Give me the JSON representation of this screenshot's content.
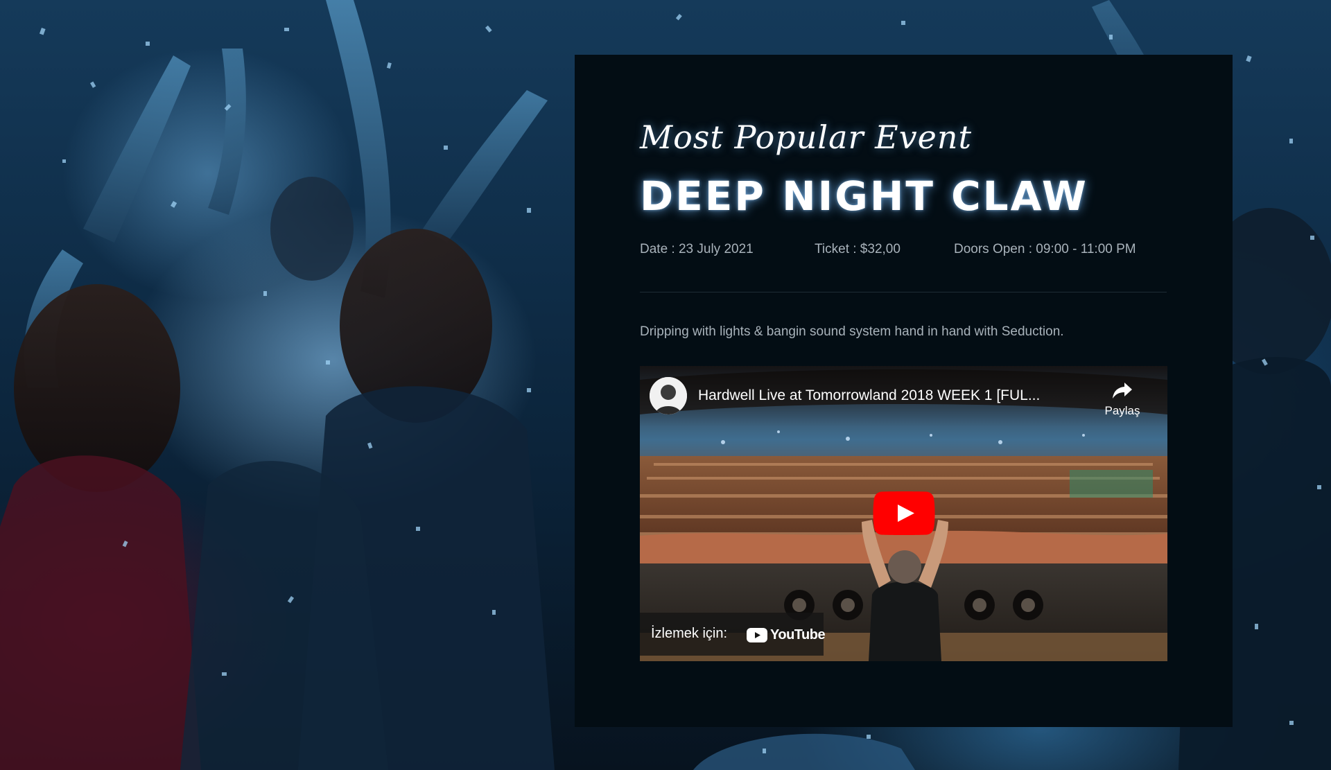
{
  "event": {
    "eyebrow": "Most Popular Event",
    "title": "DEEP NIGHT CLAW",
    "date": "Date : 23 July 2021",
    "ticket": "Ticket : $32,00",
    "doors": "Doors Open : 09:00 - 11:00 PM",
    "description": "Dripping with lights & bangin sound system hand in hand with Seduction."
  },
  "video": {
    "title": "Hardwell Live at Tomorrowland 2018 WEEK 1 [FUL...",
    "share_label": "Paylaş",
    "watch_label": "İzlemek için:",
    "platform": "YouTube"
  },
  "icons": {
    "share": "share-arrow-icon",
    "play": "youtube-play-icon",
    "channel": "channel-avatar-icon"
  },
  "colors": {
    "panel_bg": "#030d14",
    "text_muted": "#a9b3bb",
    "youtube_red": "#ff0000",
    "glow": "#78beff"
  }
}
